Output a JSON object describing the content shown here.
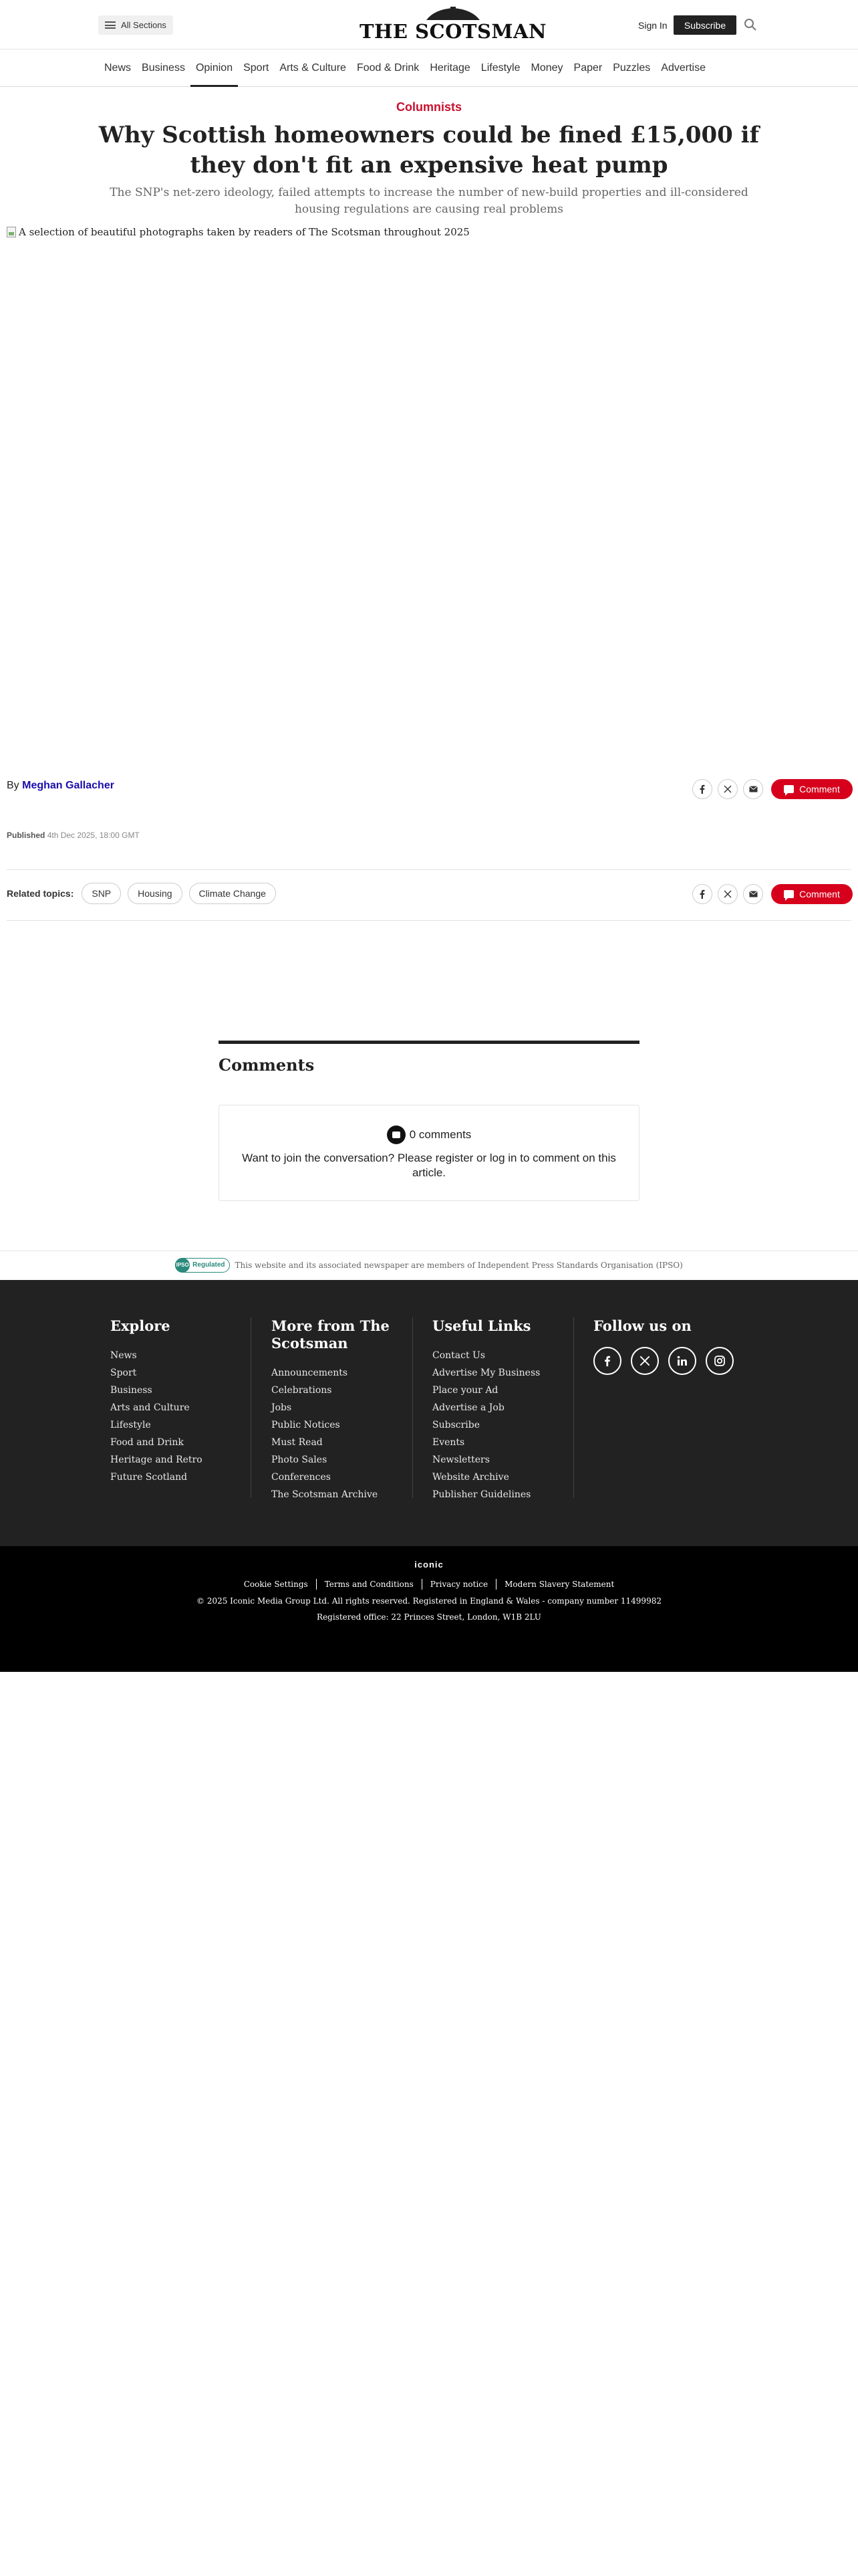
{
  "header": {
    "all_sections_label": "All Sections",
    "logo_text": "THE SCOTSMAN",
    "signin_label": "Sign In",
    "subscribe_label": "Subscribe"
  },
  "nav": {
    "items": [
      "News",
      "Business",
      "Opinion",
      "Sport",
      "Arts & Culture",
      "Food & Drink",
      "Heritage",
      "Lifestyle",
      "Money",
      "Paper",
      "Puzzles",
      "Advertise"
    ],
    "active": "Opinion"
  },
  "article": {
    "kicker": "Columnists",
    "headline": "Why Scottish homeowners could be fined £15,000 if they don't fit an expensive heat pump",
    "standfirst": "The SNP's net-zero ideology, failed attempts to increase the number of new-build properties and ill-considered housing regulations are causing real problems",
    "hero_alt": "A selection of beautiful photographs taken by readers of The Scotsman throughout 2025",
    "byline_prefix": "By",
    "author": "Meghan Gallacher",
    "published_label": "Published",
    "published_date": "4th Dec 2025, 18:00 GMT",
    "comment_label": "Comment"
  },
  "topics": {
    "label": "Related topics:",
    "items": [
      "SNP",
      "Housing",
      "Climate Change"
    ]
  },
  "comments": {
    "title": "Comments",
    "count_text": "0 comments",
    "prompt": "Want to join the conversation? Please register or log in to comment on this article."
  },
  "ipso": {
    "badge_ring": "IPSO",
    "badge_text": "Regulated",
    "text": "This website and its associated newspaper are members of Independent Press Standards Organisation (IPSO)"
  },
  "footer": {
    "explore": {
      "title": "Explore",
      "links": [
        "News",
        "Sport",
        "Business",
        "Arts and Culture",
        "Lifestyle",
        "Food and Drink",
        "Heritage and Retro",
        "Future Scotland"
      ]
    },
    "more": {
      "title": "More from The Scotsman",
      "links": [
        "Announcements",
        "Celebrations",
        "Jobs",
        "Public Notices",
        "Must Read",
        "Photo Sales",
        "Conferences",
        "The Scotsman Archive"
      ]
    },
    "useful": {
      "title": "Useful Links",
      "links": [
        "Contact Us",
        "Advertise My Business",
        "Place your Ad",
        "Advertise a Job",
        "Subscribe",
        "Events",
        "Newsletters",
        "Website Archive",
        "Publisher Guidelines"
      ]
    },
    "follow": {
      "title": "Follow us on",
      "icons": [
        "facebook-icon",
        "x-icon",
        "linkedin-icon",
        "instagram-icon"
      ]
    }
  },
  "bottom": {
    "brand": "iconic",
    "links": [
      "Cookie Settings",
      "Terms and Conditions",
      "Privacy notice",
      "Modern Slavery Statement"
    ],
    "copyright": "© 2025 Iconic Media Group Ltd. All rights reserved. Registered in England & Wales - company number 11499982",
    "registered_office": "Registered office: 22 Princes Street, London, W1B 2LU"
  },
  "colors": {
    "accent": "#c8102e",
    "comment_button": "#d6001c",
    "footer_bg": "#222222",
    "bottom_bg": "#000000",
    "author_link": "#1a0dab"
  }
}
